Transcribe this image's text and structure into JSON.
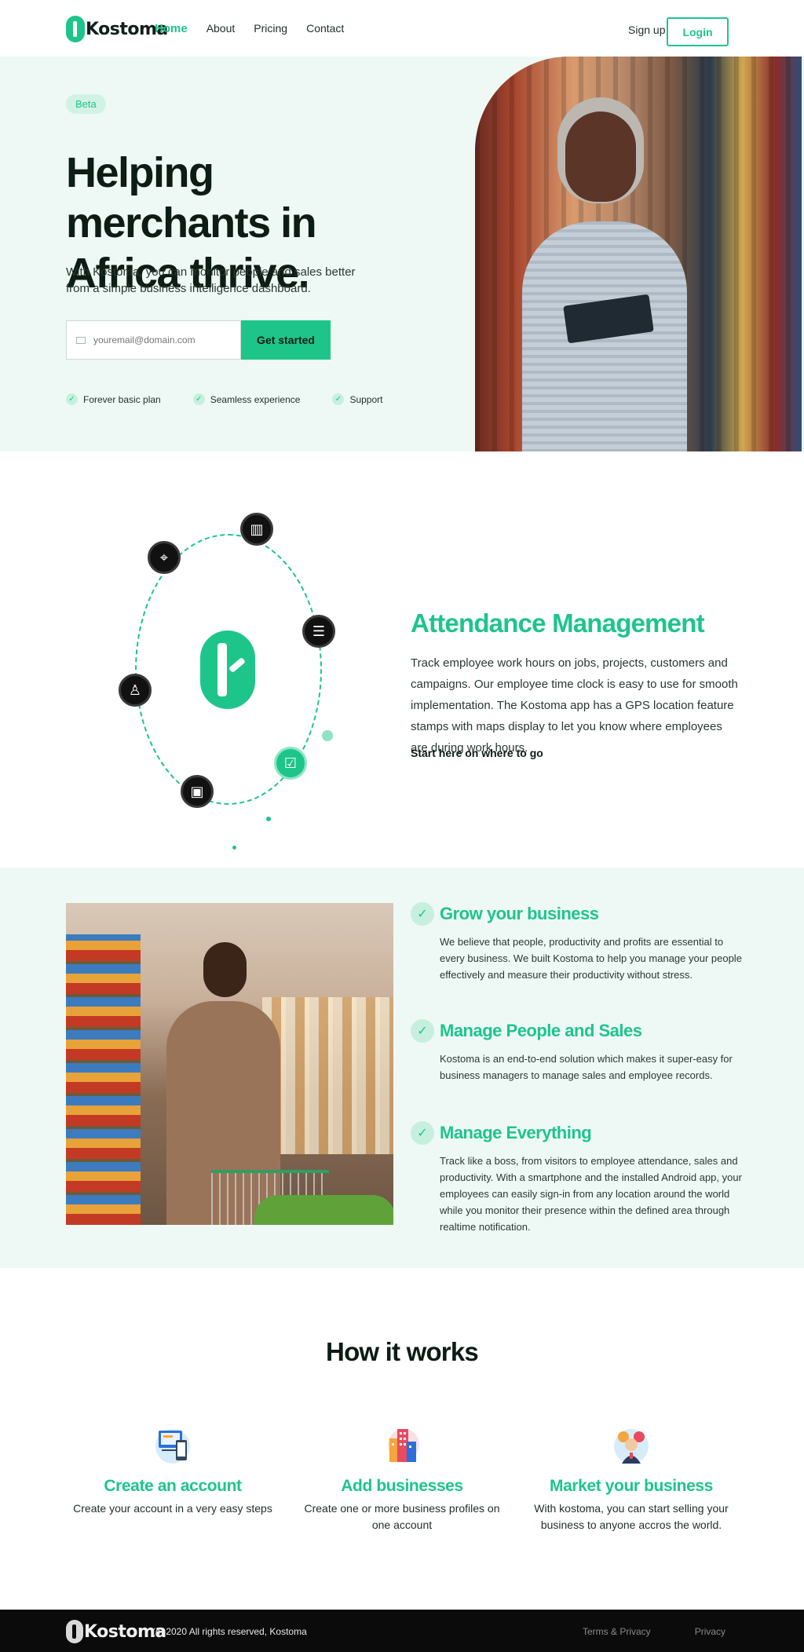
{
  "nav": {
    "logo": "Kostoma",
    "links": [
      "Home",
      "About",
      "Pricing",
      "Contact"
    ],
    "signup": "Sign up",
    "login": "Login"
  },
  "hero": {
    "badge": "Beta",
    "title": "Helping merchants in Africa thrive.",
    "subtitle": "With Kostoma, you can monitor people and sales better from a simple business intelligence dashboard.",
    "email_placeholder": "youremail@domain.com",
    "cta": "Get started",
    "perks": [
      "Forever basic plan",
      "Seamless experience",
      "Support"
    ]
  },
  "attendance": {
    "title": "Attendance Management",
    "text": "Track employee work hours on jobs, projects, customers and campaigns. Our employee time clock is easy to use for smooth implementation. The Kostoma app has a GPS location feature stamps with maps display to let you know where employees are during work hours.",
    "link": "Start here on where to go",
    "icons": [
      "building-icon",
      "checklist-icon",
      "calendar-check-icon",
      "wallet-icon",
      "user-icon",
      "location-pin-icon"
    ]
  },
  "features": [
    {
      "title": "Grow your business",
      "text": "We believe that people, productivity and profits are essential to every business. We built Kostoma to help you manage your people effectively and measure their productivity without stress."
    },
    {
      "title": "Manage People and Sales",
      "text": "Kostoma is an end-to-end solution which makes it super-easy for business managers to manage sales and employee records."
    },
    {
      "title": "Manage Everything",
      "text": "Track like a boss, from visitors to employee attendance, sales and productivity. With a smartphone and the installed Android app, your employees can easily sign-in from any location around the world while you monitor their presence within the defined area through realtime notification."
    }
  ],
  "how": {
    "title": "How it works",
    "steps": [
      {
        "title": "Create an account",
        "text": "Create your account in a very easy steps"
      },
      {
        "title": "Add businesses",
        "text": "Create one or more business profiles on one account"
      },
      {
        "title": "Market your business",
        "text": "With kostoma, you can start selling your business to anyone accros the world."
      }
    ]
  },
  "footer": {
    "logo": "Kostoma",
    "copyright": "(c) 2020 All rights reserved, Kostoma",
    "links": [
      "Terms & Privacy",
      "Privacy"
    ]
  },
  "colors": {
    "accent": "#1dc58b",
    "hero_bg": "#eef9f5",
    "footer_bg": "#0b0b0b"
  }
}
